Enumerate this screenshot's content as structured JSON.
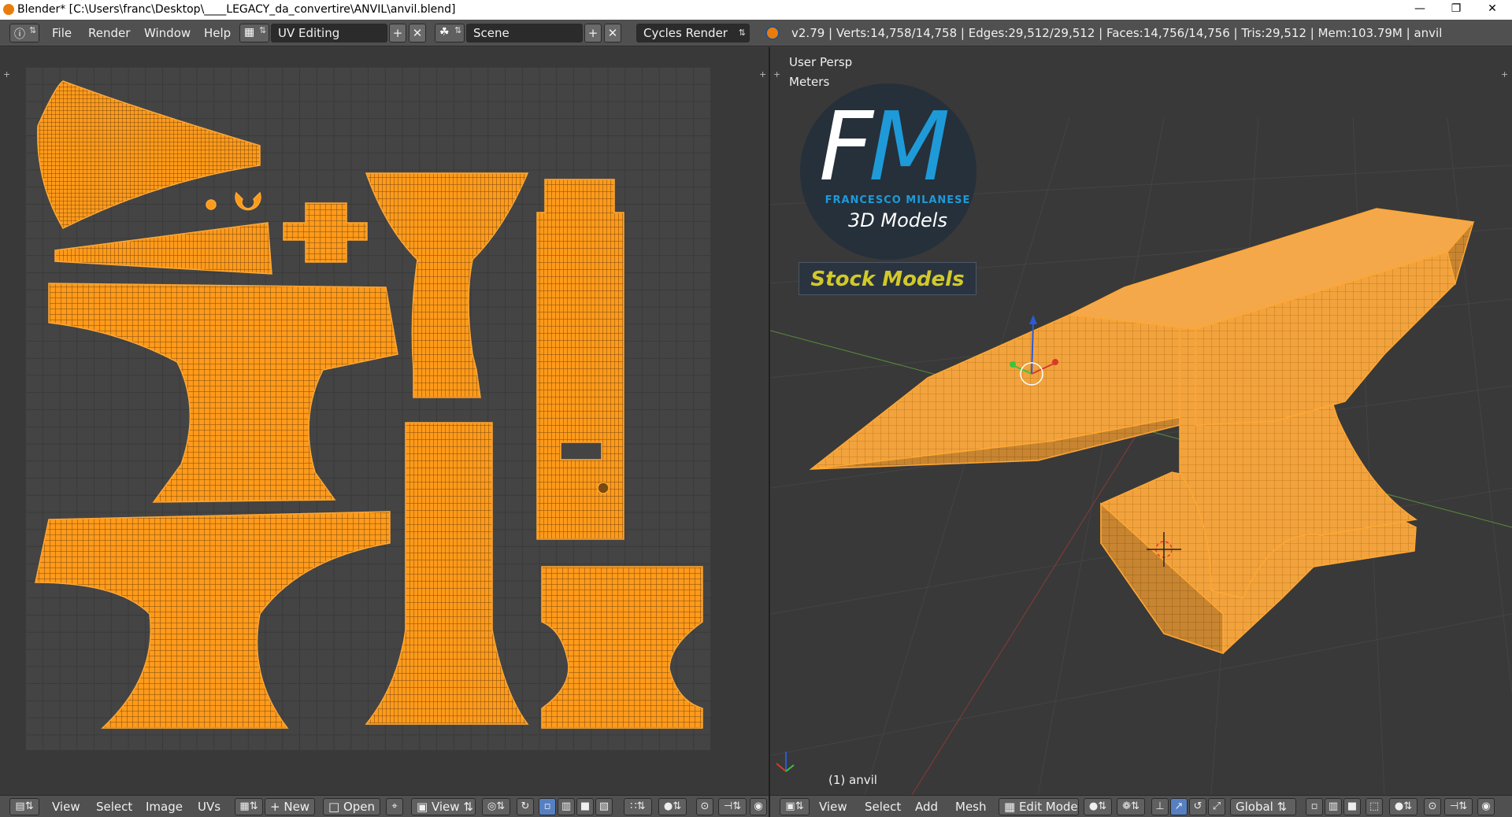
{
  "window": {
    "title": "Blender* [C:\\Users\\franc\\Desktop\\____LEGACY_da_convertire\\ANVIL\\anvil.blend]",
    "min_icon": "minimize-icon",
    "max_icon": "restore-icon",
    "close_icon": "close-icon"
  },
  "topbar": {
    "menus": [
      "File",
      "Render",
      "Window",
      "Help"
    ],
    "screen_layout": "UV Editing",
    "scene": "Scene",
    "render_engine": "Cycles Render",
    "stats": "v2.79 | Verts:14,758/14,758 | Edges:29,512/29,512 | Faces:14,756/14,756 | Tris:29,512 | Mem:103.79M | anvil"
  },
  "viewport": {
    "view_name": "User Persp",
    "units": "Meters",
    "object_label": "(1) anvil"
  },
  "logo": {
    "letters_f": "F",
    "letters_m": "M",
    "name": "FRANCESCO MILANESE",
    "subtitle": "3D Models",
    "banner": "Stock Models"
  },
  "uv_bottombar": {
    "menus": [
      "View",
      "Select",
      "Image",
      "UVs"
    ],
    "new_label": "New",
    "open_label": "Open",
    "view_label": "View"
  },
  "view3d_bottombar": {
    "menus": [
      "View",
      "Select",
      "Add",
      "Mesh"
    ],
    "mode": "Edit Mode",
    "orientation": "Global"
  },
  "colors": {
    "mesh_orange": "#ff9a1a",
    "ui_gray": "#505050",
    "accent_blue": "#1e9ad9",
    "stock_yellow": "#d2c92a"
  }
}
